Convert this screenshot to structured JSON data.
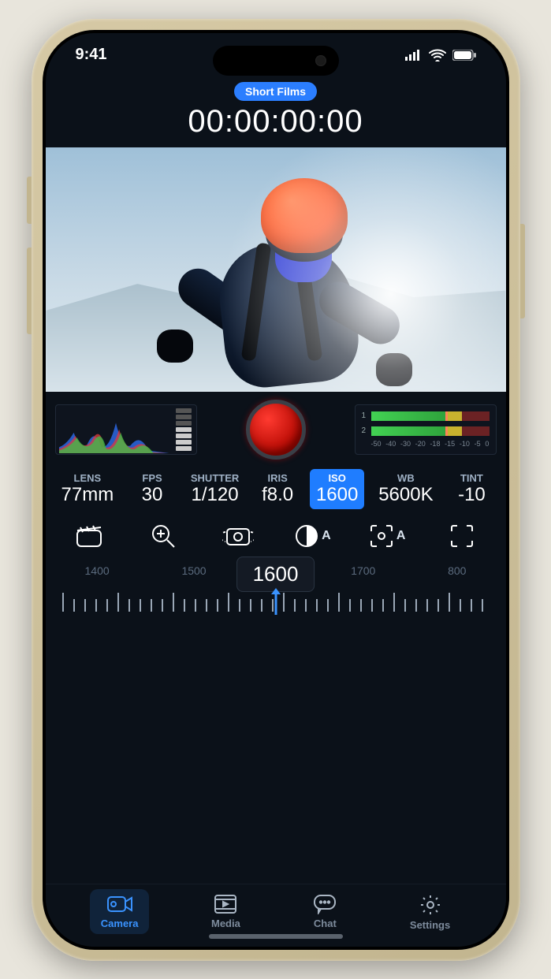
{
  "status": {
    "time": "9:41"
  },
  "header": {
    "project": "Short Films",
    "timecode": "00:00:00:00"
  },
  "params": {
    "lens": {
      "label": "LENS",
      "value": "77mm"
    },
    "fps": {
      "label": "FPS",
      "value": "30"
    },
    "shutter": {
      "label": "SHUTTER",
      "value": "1/120"
    },
    "iris": {
      "label": "IRIS",
      "value": "f8.0"
    },
    "iso": {
      "label": "ISO",
      "value": "1600"
    },
    "wb": {
      "label": "WB",
      "value": "5600K"
    },
    "tint": {
      "label": "TINT",
      "value": "-10"
    }
  },
  "tool_auto_suffix": "A",
  "ruler": {
    "current": "1600",
    "labels": [
      "1400",
      "1500",
      "",
      "1700",
      "800"
    ]
  },
  "audio": {
    "ticks": [
      "-50",
      "-40",
      "-30",
      "-20",
      "-18",
      "-15",
      "-10",
      "-5",
      "0"
    ]
  },
  "tabs": {
    "camera": "Camera",
    "media": "Media",
    "chat": "Chat",
    "settings": "Settings"
  }
}
